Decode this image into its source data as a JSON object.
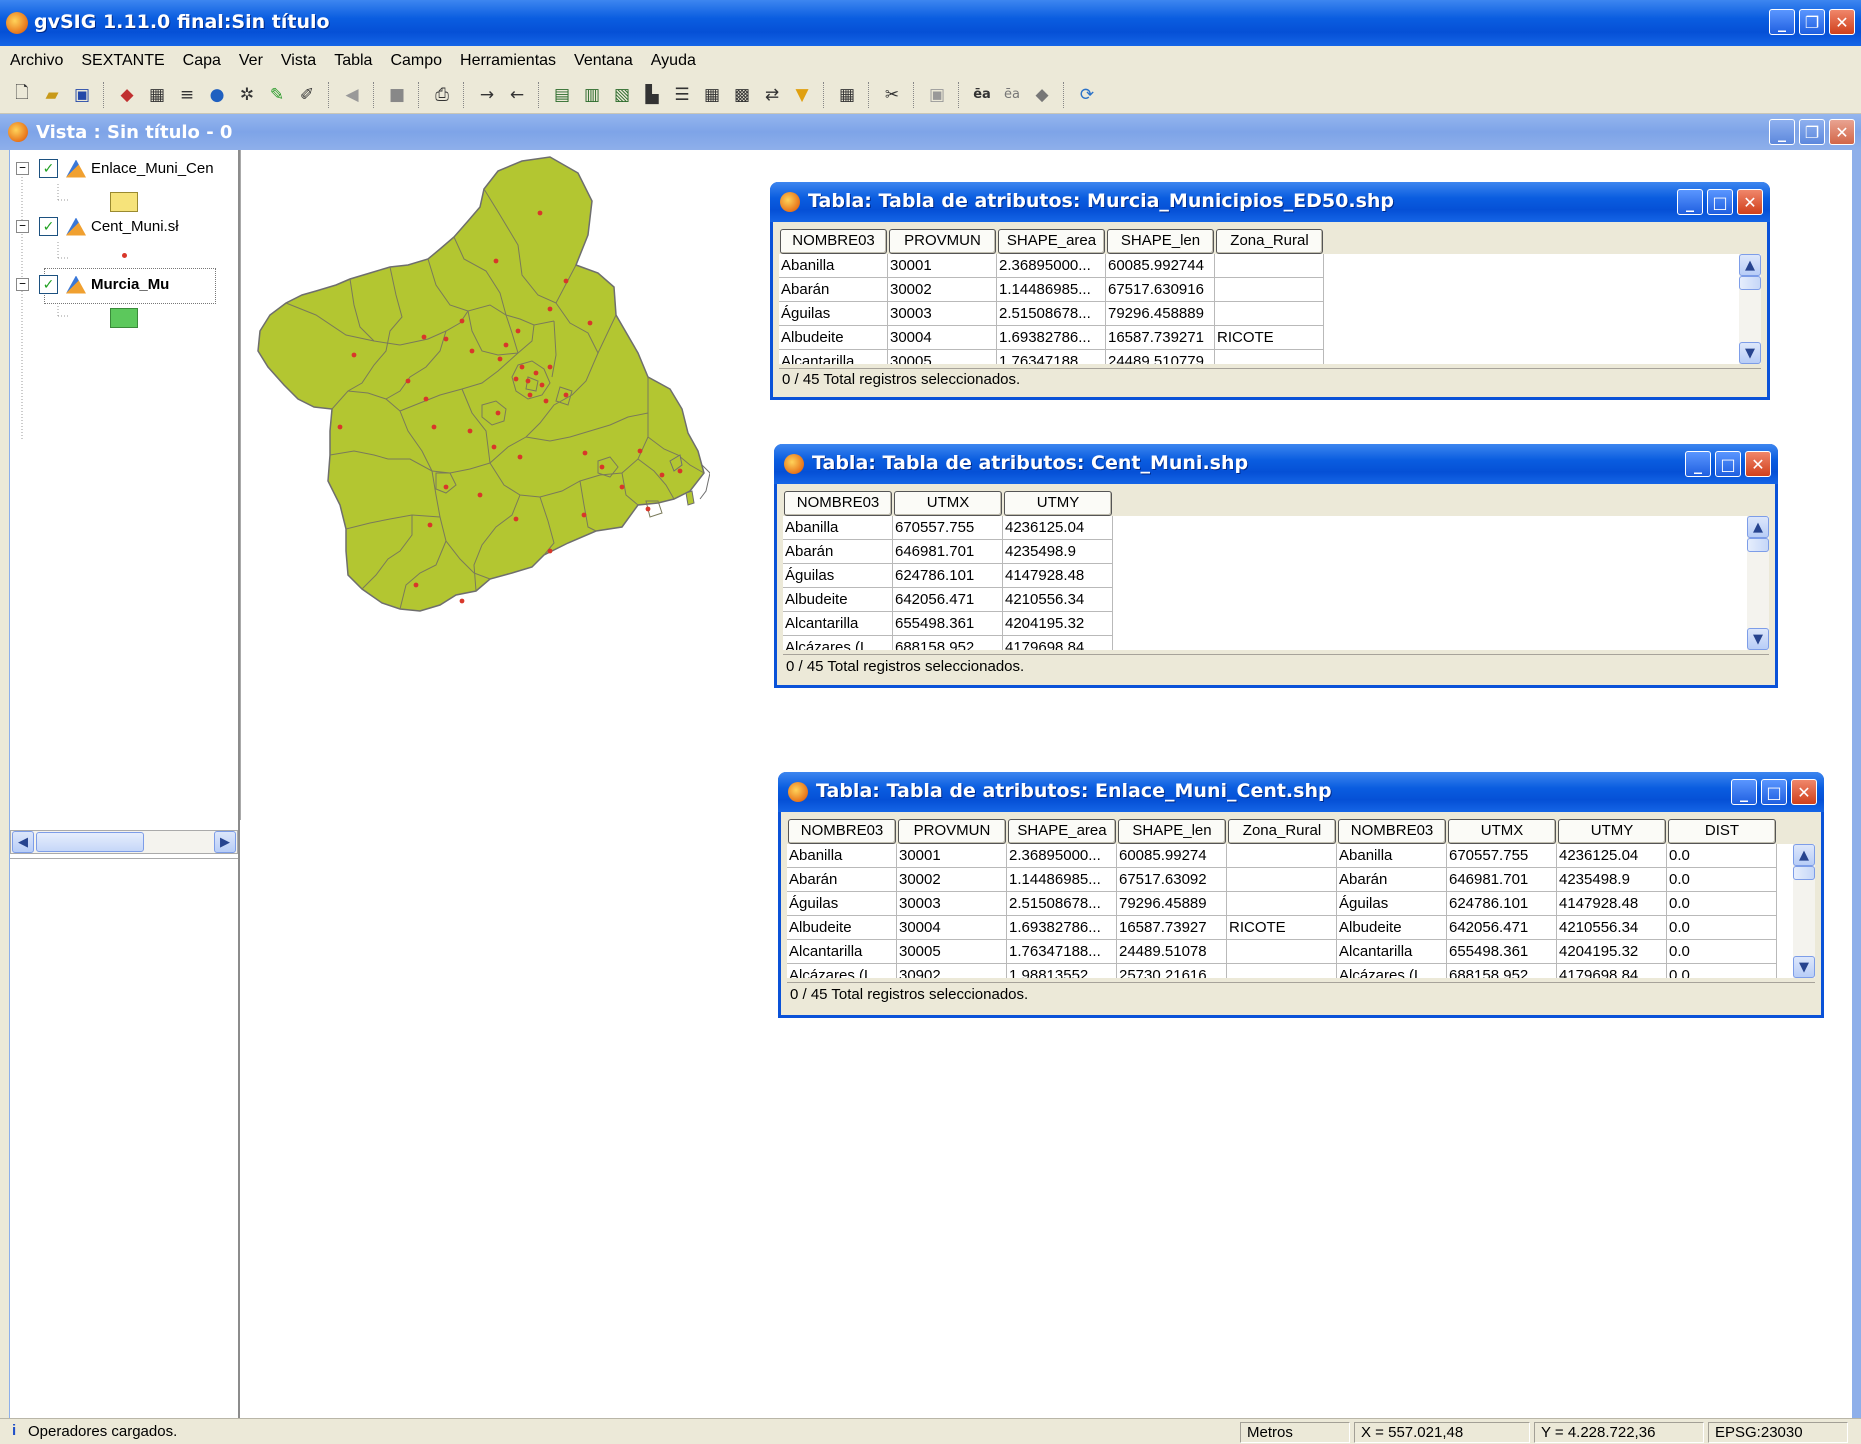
{
  "app": {
    "title": "gvSIG 1.11.0 final:Sin título",
    "window_buttons": [
      "minimize-icon",
      "restore-icon",
      "close-icon"
    ]
  },
  "menu": [
    "Archivo",
    "SEXTANTE",
    "Capa",
    "Ver",
    "Vista",
    "Tabla",
    "Campo",
    "Herramientas",
    "Ventana",
    "Ayuda"
  ],
  "toolbar_icons": [
    "new-icon",
    "open-icon",
    "save-icon",
    "add-layer-icon",
    "raster-icon",
    "layer-icon",
    "globe-icon",
    "settings-icon",
    "edit-icon",
    "pencil-icon",
    "back-icon",
    "select-icon",
    "print-icon",
    "arrow-right-icon",
    "arrow-left-icon",
    "table-icon",
    "table-join-icon",
    "table-link-icon",
    "statistics-icon",
    "sort-icon",
    "grid-icon",
    "grid2-icon",
    "swap-icon",
    "filter-icon",
    "calculator-icon",
    "tools-icon",
    "layout-icon",
    "label-icon",
    "label2-icon",
    "eraser-icon",
    "refresh-icon"
  ],
  "view": {
    "title": "Vista : Sin título - 0"
  },
  "toc": {
    "layers": [
      {
        "name": "Enlace_Muni_Cen",
        "checked": true,
        "bold": false,
        "legend": "polygon-yellow"
      },
      {
        "name": "Cent_Muni.sł",
        "checked": true,
        "bold": false,
        "legend": "point-red"
      },
      {
        "name": "Murcia_Mu",
        "checked": true,
        "bold": true,
        "legend": "polygon-green"
      }
    ],
    "check_mark": "✓",
    "expand_mark": "−"
  },
  "colors": {
    "map_fill": "#b3c631",
    "map_stroke": "#6e6e6e",
    "point": "#d8372a",
    "title_blue": "#0a52d8",
    "yellow_legend": "#f6e37a",
    "green_legend": "#5cc85c"
  },
  "tables": [
    {
      "title": "Tabla: Tabla de atributos: Murcia_Municipios_ED50.shp",
      "columns": [
        "NOMBRE03",
        "PROVMUN",
        "SHAPE_area",
        "SHAPE_len",
        "Zona_Rural"
      ],
      "rows": [
        [
          "Abanilla",
          "30001",
          "2.36895000...",
          "60085.992744",
          ""
        ],
        [
          "Abarán",
          "30002",
          "1.14486985...",
          "67517.630916",
          ""
        ],
        [
          "Águilas",
          "30003",
          "2.51508678...",
          "79296.458889",
          ""
        ],
        [
          "Albudeite",
          "30004",
          "1.69382786...",
          "16587.739271",
          "RICOTE"
        ],
        [
          "Alcantarilla",
          "30005",
          "1.76347188...",
          "24489.510779",
          ""
        ]
      ],
      "status": "0 / 45 Total registros seleccionados."
    },
    {
      "title": "Tabla: Tabla de atributos: Cent_Muni.shp",
      "columns": [
        "NOMBRE03",
        "UTMX",
        "UTMY"
      ],
      "rows": [
        [
          "Abanilla",
          "670557.755",
          "4236125.04"
        ],
        [
          "Abarán",
          "646981.701",
          "4235498.9"
        ],
        [
          "Águilas",
          "624786.101",
          "4147928.48"
        ],
        [
          "Albudeite",
          "642056.471",
          "4210556.34"
        ],
        [
          "Alcantarilla",
          "655498.361",
          "4204195.32"
        ],
        [
          "Alcázares (L...",
          "688158.952",
          "4179698.84"
        ]
      ],
      "status": "0 / 45 Total registros seleccionados."
    },
    {
      "title": "Tabla: Tabla de atributos: Enlace_Muni_Cent.shp",
      "columns": [
        "NOMBRE03",
        "PROVMUN",
        "SHAPE_area",
        "SHAPE_len",
        "Zona_Rural",
        "NOMBRE03",
        "UTMX",
        "UTMY",
        "DIST"
      ],
      "rows": [
        [
          "Abanilla",
          "30001",
          "2.36895000...",
          "60085.99274",
          "",
          "Abanilla",
          "670557.755",
          "4236125.04",
          "0.0"
        ],
        [
          "Abarán",
          "30002",
          "1.14486985...",
          "67517.63092",
          "",
          "Abarán",
          "646981.701",
          "4235498.9",
          "0.0"
        ],
        [
          "Águilas",
          "30003",
          "2.51508678...",
          "79296.45889",
          "",
          "Águilas",
          "624786.101",
          "4147928.48",
          "0.0"
        ],
        [
          "Albudeite",
          "30004",
          "1.69382786...",
          "16587.73927",
          "RICOTE",
          "Albudeite",
          "642056.471",
          "4210556.34",
          "0.0"
        ],
        [
          "Alcantarilla",
          "30005",
          "1.76347188...",
          "24489.51078",
          "",
          "Alcantarilla",
          "655498.361",
          "4204195.32",
          "0.0"
        ],
        [
          "Alcázares (L...",
          "30902",
          "1.98813552...",
          "25730.21616",
          "",
          "Alcázares (L...",
          "688158.952",
          "4179698.84",
          "0.0"
        ]
      ],
      "status": "0 / 45 Total registros seleccionados."
    }
  ],
  "statusbar": {
    "message": "Operadores cargados.",
    "info_icon": "i",
    "units": "Metros",
    "x": "X = 557.021,48",
    "y": "Y = 4.228.722,36",
    "crs": "EPSG:23030"
  }
}
